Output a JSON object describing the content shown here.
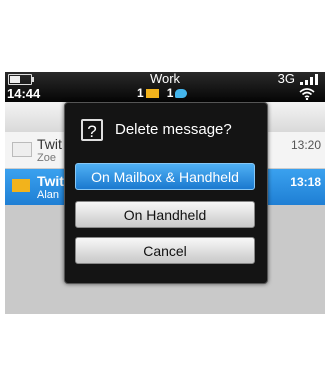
{
  "status_bar": {
    "title": "Work",
    "time": "14:44",
    "network": "3G",
    "notifications": [
      {
        "count": "1",
        "icon": "envelope-icon"
      },
      {
        "count": "1",
        "icon": "twitter-icon"
      }
    ]
  },
  "messages": [
    {
      "from": "Twit",
      "preview": "Zoe",
      "time": "13:20",
      "selected": false
    },
    {
      "from": "Twit",
      "preview": "Alan",
      "time": "13:18",
      "selected": true
    }
  ],
  "dialog": {
    "title": "Delete message?",
    "icon": "question-icon",
    "buttons": {
      "mailbox_handheld": "On Mailbox & Handheld",
      "handheld": "On Handheld",
      "cancel": "Cancel"
    }
  },
  "colors": {
    "selection": "#2b8ce0",
    "dialog_bg": "#141414",
    "envelope": "#f2b31c",
    "twitter": "#44b5ec"
  }
}
